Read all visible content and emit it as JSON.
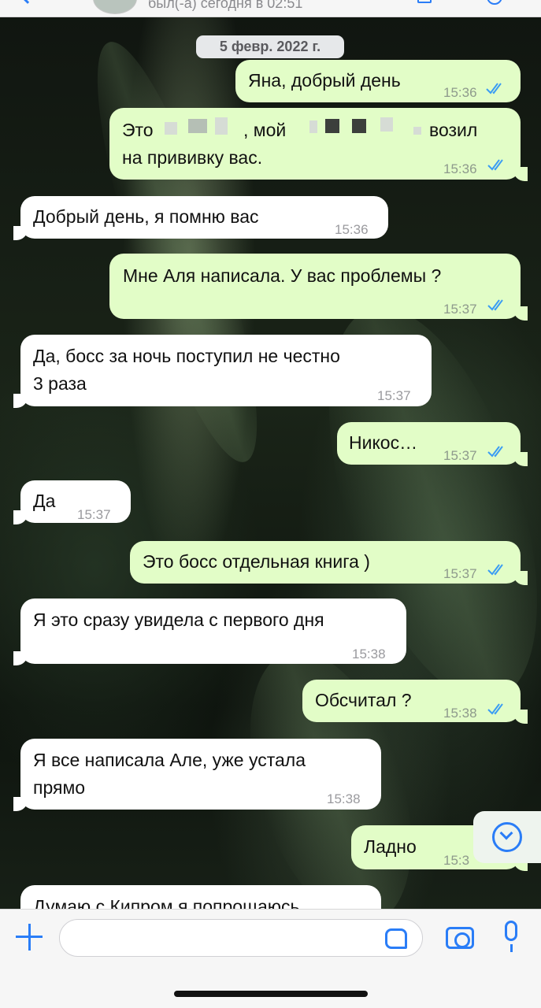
{
  "header": {
    "status": "был(-а) сегодня в 02:51"
  },
  "date_separator": "5 февр. 2022 г.",
  "messages": [
    {
      "dir": "out",
      "lines": [
        "Яна, добрый день"
      ],
      "time": "15:36",
      "read": true
    },
    {
      "dir": "out",
      "lines": [
        "Это",
        ", мой",
        "возил",
        "на прививку вас."
      ],
      "time": "15:36",
      "read": true
    },
    {
      "dir": "in",
      "lines": [
        "Добрый день, я помню вас"
      ],
      "time": "15:36"
    },
    {
      "dir": "out",
      "lines": [
        "Мне Аля написала. У вас проблемы ?"
      ],
      "time": "15:37",
      "read": true
    },
    {
      "dir": "in",
      "lines": [
        "Да, босс за ночь поступил не честно",
        "3 раза"
      ],
      "time": "15:37"
    },
    {
      "dir": "out",
      "lines": [
        "Никос…"
      ],
      "time": "15:37",
      "read": true
    },
    {
      "dir": "in",
      "lines": [
        "Да"
      ],
      "time": "15:37"
    },
    {
      "dir": "out",
      "lines": [
        "Это босс отдельная книга )"
      ],
      "time": "15:37",
      "read": true
    },
    {
      "dir": "in",
      "lines": [
        "Я это сразу увидела с первого дня"
      ],
      "time": "15:38"
    },
    {
      "dir": "out",
      "lines": [
        "Обсчитал ?"
      ],
      "time": "15:38",
      "read": true
    },
    {
      "dir": "in",
      "lines": [
        "Я все написала Але, уже устала",
        "прямо"
      ],
      "time": "15:38"
    },
    {
      "dir": "out",
      "lines": [
        "Ладно"
      ],
      "time": "15:3"
    },
    {
      "dir": "in",
      "lines": [
        "Думаю с Кипром я попрощаюсь"
      ],
      "time": ""
    }
  ],
  "composer": {
    "value": "",
    "placeholder": ""
  },
  "icons": [
    "back-icon",
    "avatar",
    "video-call-icon",
    "phone-icon",
    "read-ticks-icon",
    "scroll-down-icon",
    "plus-icon",
    "sticker-icon",
    "camera-icon",
    "mic-icon"
  ],
  "colors": {
    "outgoing_bubble": "#e2fdc7",
    "incoming_bubble": "#ffffff",
    "accent": "#2a7df7",
    "read_ticks": "#3a9cf4"
  }
}
